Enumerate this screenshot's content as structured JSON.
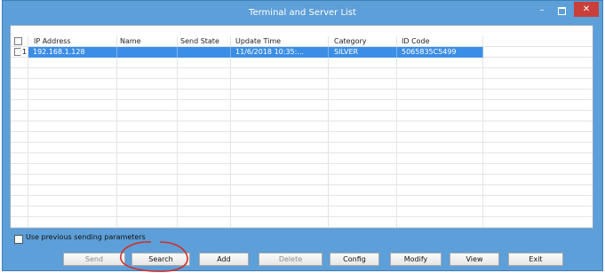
{
  "window": {
    "title": "Terminal and Server List",
    "minimize_glyph": "–",
    "close_glyph": "✕"
  },
  "table": {
    "columns": [
      "IP Address",
      "Name",
      "Send State",
      "Update Time",
      "Category",
      "ID Code"
    ],
    "rows": [
      {
        "index": "1",
        "ip": "192.168.1.128",
        "name": "",
        "send_state": "",
        "update_time": "11/6/2018 10:35:...",
        "category": "SILVER",
        "id_code": "5065835C5499",
        "selected": true
      }
    ]
  },
  "options": {
    "use_previous_label": "Use previous sending parameters"
  },
  "buttons": {
    "send": "Send",
    "search": "Search",
    "add": "Add",
    "delete": "Delete",
    "config": "Config",
    "modify": "Modify",
    "view": "View",
    "exit": "Exit"
  },
  "colors": {
    "titlebar": "#5d9fd8",
    "selection": "#3b8ee6",
    "close_button": "#c9403a",
    "annotation_circle": "#d0302a"
  }
}
